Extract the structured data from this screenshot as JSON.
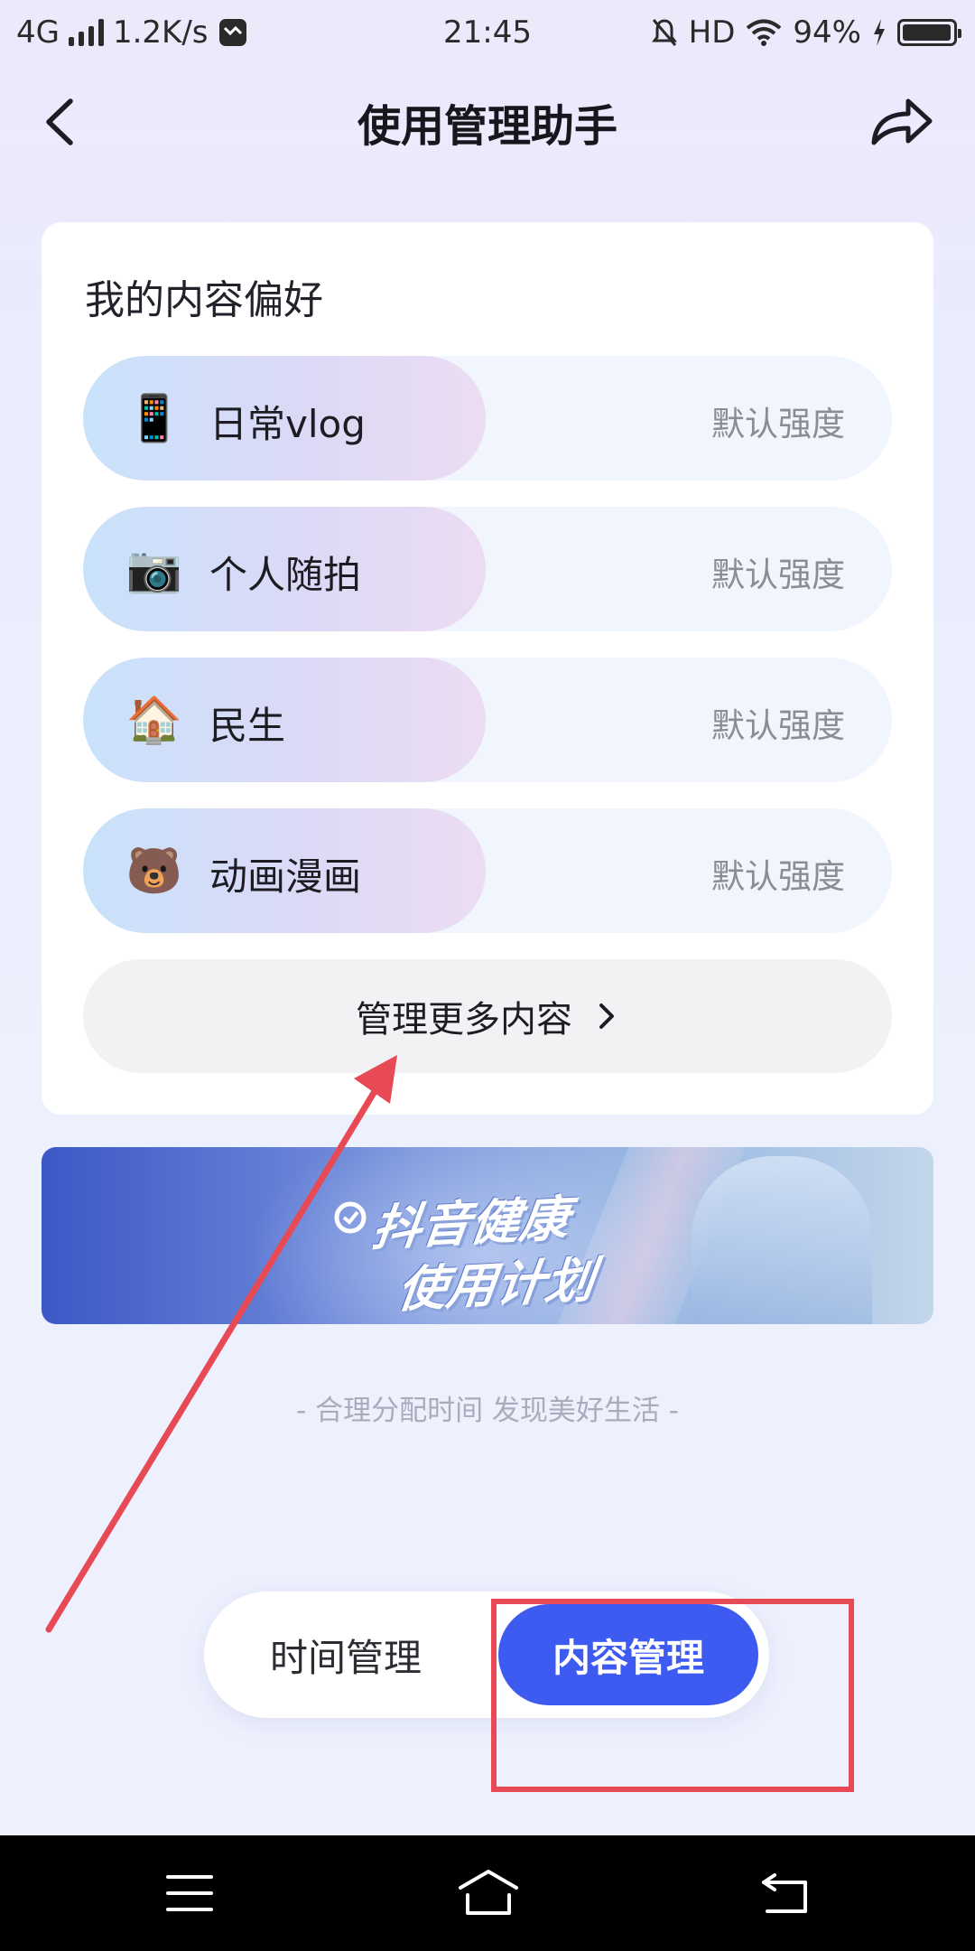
{
  "status_bar": {
    "network": "4G",
    "speed": "1.2K/s",
    "time": "21:45",
    "hd": "HD",
    "battery": "94%",
    "icons": [
      "signal-icon",
      "notification-app-icon",
      "mute-bell-icon",
      "wifi-icon",
      "charging-icon",
      "battery-icon"
    ]
  },
  "header": {
    "title": "使用管理助手",
    "back_icon": "chevron-left-icon",
    "share_icon": "share-icon"
  },
  "preferences": {
    "title": "我的内容偏好",
    "items": [
      {
        "label": "日常vlog",
        "level": "默认强度",
        "icon": "phone-vlog-icon",
        "emoji": "📱"
      },
      {
        "label": "个人随拍",
        "level": "默认强度",
        "icon": "camera-selfie-icon",
        "emoji": "📷"
      },
      {
        "label": "民生",
        "level": "默认强度",
        "icon": "house-hand-icon",
        "emoji": "🏠"
      },
      {
        "label": "动画漫画",
        "level": "默认强度",
        "icon": "bear-face-icon",
        "emoji": "🐻"
      }
    ],
    "manage_more_label": "管理更多内容"
  },
  "banner": {
    "line1": "抖音健康",
    "line2": "使用计划"
  },
  "slogan": "- 合理分配时间 发现美好生活 -",
  "mode_toggle": {
    "tabs": [
      "时间管理",
      "内容管理"
    ],
    "selected": "内容管理"
  },
  "colors": {
    "accent": "#3d5af1",
    "annotation": "#e84a55"
  },
  "nav_bar": {
    "icons": [
      "menu-icon",
      "home-icon",
      "back-icon"
    ]
  }
}
